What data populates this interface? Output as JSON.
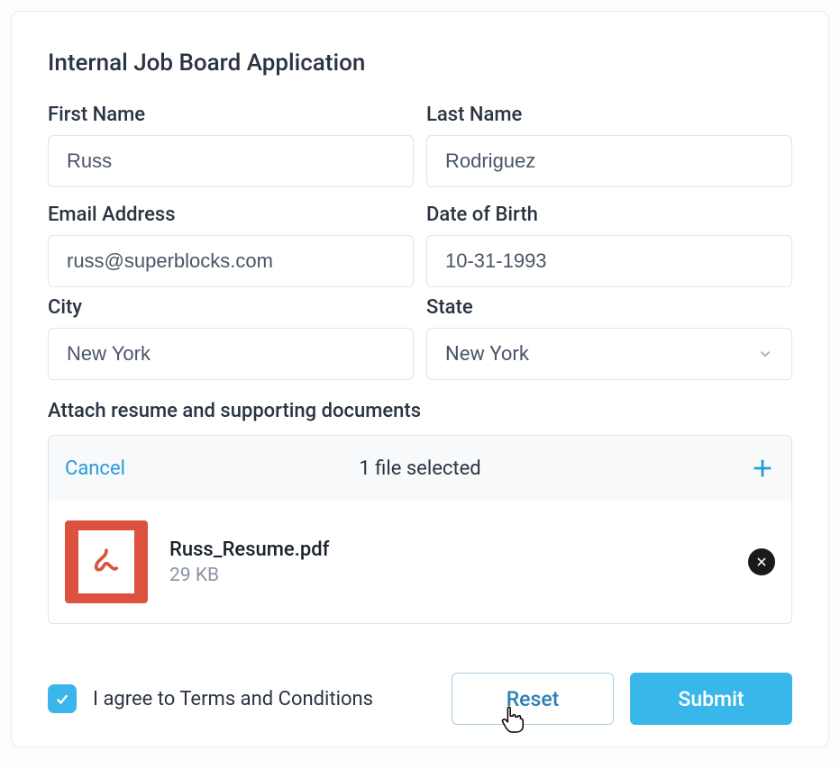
{
  "title": "Internal Job Board Application",
  "fields": {
    "first_name": {
      "label": "First Name",
      "value": "Russ"
    },
    "last_name": {
      "label": "Last Name",
      "value": "Rodriguez"
    },
    "email": {
      "label": "Email Address",
      "value": "russ@superblocks.com"
    },
    "dob": {
      "label": "Date of Birth",
      "value": "10-31-1993"
    },
    "city": {
      "label": "City",
      "value": "New York"
    },
    "state": {
      "label": "State",
      "value": "New York"
    }
  },
  "attach": {
    "label": "Attach resume and supporting documents",
    "cancel": "Cancel",
    "status": "1 file selected",
    "file": {
      "name": "Russ_Resume.pdf",
      "size": "29 KB"
    }
  },
  "footer": {
    "agree": "I agree to Terms and Conditions",
    "reset": "Reset",
    "submit": "Submit",
    "agree_checked": true
  },
  "colors": {
    "accent": "#39b6ea",
    "link": "#2b9bd8",
    "pdf": "#dd513f"
  }
}
